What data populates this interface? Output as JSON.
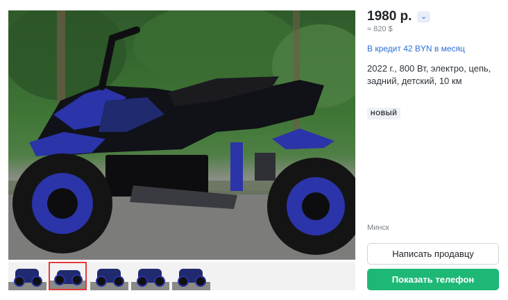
{
  "listing": {
    "price": "1980 р.",
    "price_approx": "≈ 820 $",
    "credit_text": "В кредит 42 BYN в месяц",
    "description": "2022 г., 800 Вт, электро, цепь, задний, детский, 10 км",
    "badge": "НОВЫЙ",
    "city": "Минск"
  },
  "actions": {
    "message_seller": "Написать продавцу",
    "show_phone": "Показать телефон"
  },
  "icons": {
    "price_toggle": "chevron-down-icon"
  },
  "colors": {
    "accent_link": "#2b6ed8",
    "primary_button": "#1eb876",
    "active_thumb_border": "#e23a3a",
    "vehicle_blue": "#2b34a8"
  },
  "gallery": {
    "thumbnail_count": 5,
    "active_index": 1
  }
}
